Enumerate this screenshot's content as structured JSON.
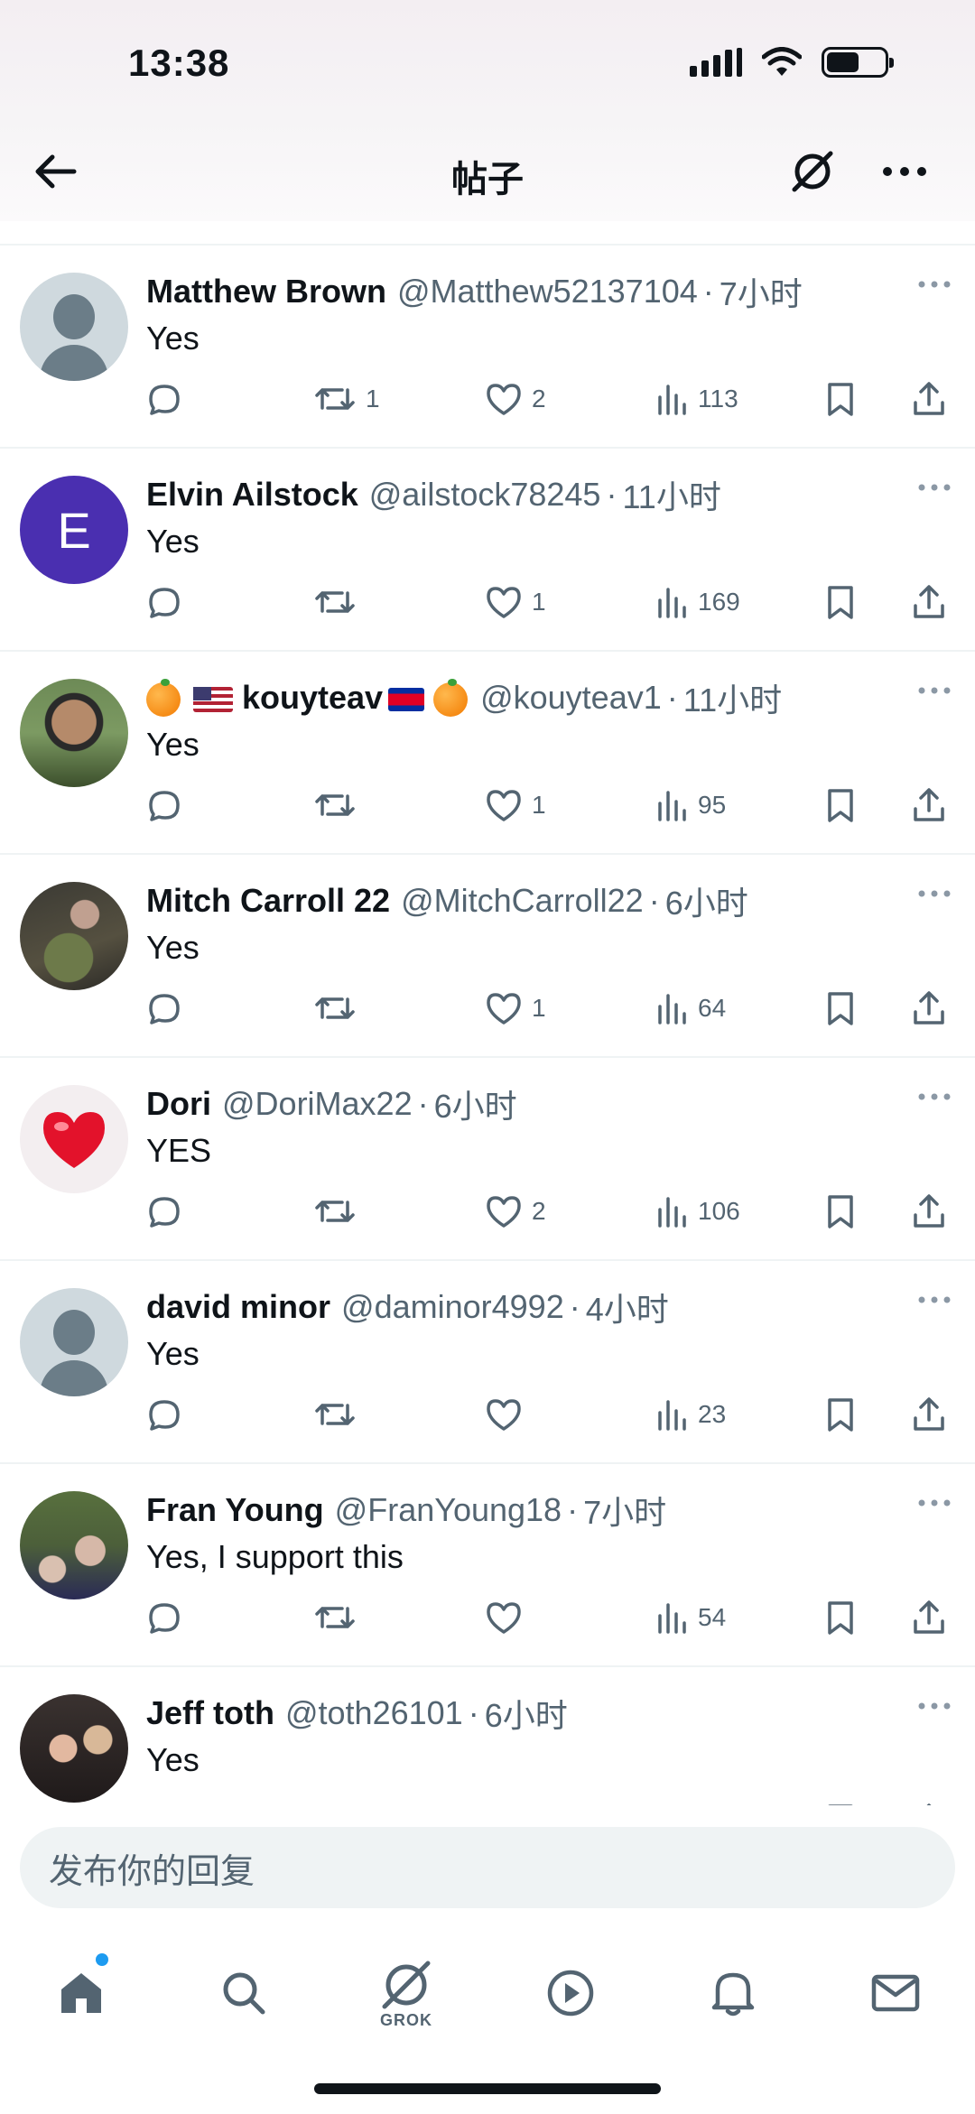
{
  "status_bar": {
    "time": "13:38"
  },
  "header": {
    "title": "帖子"
  },
  "replies": [
    {
      "name": "Matthew Brown",
      "handle": "@Matthew52137104",
      "time": "7小时",
      "text": "Yes",
      "replies": "",
      "reposts": "1",
      "likes": "2",
      "views": "113",
      "avatar": "default-avatar"
    },
    {
      "name": "Elvin Ailstock",
      "handle": "@ailstock78245",
      "time": "11小时",
      "text": "Yes",
      "replies": "",
      "reposts": "",
      "likes": "1",
      "views": "169",
      "avatar": "letter-avatar",
      "avatar_letter": "E"
    },
    {
      "name": "kouyteav",
      "handle": "@kouyteav1",
      "time": "11小时",
      "text": "Yes",
      "replies": "",
      "reposts": "",
      "likes": "1",
      "views": "95",
      "avatar": "photo-avatar"
    },
    {
      "name": "Mitch Carroll 22",
      "handle": "@MitchCarroll22",
      "time": "6小时",
      "text": "Yes",
      "replies": "",
      "reposts": "",
      "likes": "1",
      "views": "64",
      "avatar": "photo-avatar"
    },
    {
      "name": "Dori",
      "handle": "@DoriMax22",
      "time": "6小时",
      "text": "YES",
      "replies": "",
      "reposts": "",
      "likes": "2",
      "views": "106",
      "avatar": "heart-avatar"
    },
    {
      "name": "david minor",
      "handle": "@daminor4992",
      "time": "4小时",
      "text": "Yes",
      "replies": "",
      "reposts": "",
      "likes": "",
      "views": "23",
      "avatar": "default-avatar"
    },
    {
      "name": "Fran Young",
      "handle": "@FranYoung18",
      "time": "7小时",
      "text": "Yes, I support this",
      "replies": "",
      "reposts": "",
      "likes": "",
      "views": "54",
      "avatar": "photo-avatar"
    },
    {
      "name": "Jeff toth",
      "handle": "@toth26101",
      "time": "6小时",
      "text": "Yes",
      "replies": "",
      "reposts": "",
      "likes": "",
      "views": "",
      "avatar": "photo-avatar"
    }
  ],
  "composer": {
    "placeholder": "发布你的回复"
  },
  "tabbar": {
    "grok_label": "GROK"
  },
  "colors": {
    "text": "#0f1419",
    "secondary": "#536471",
    "divider": "#eff3f4",
    "accent": "#1d9bf0"
  }
}
